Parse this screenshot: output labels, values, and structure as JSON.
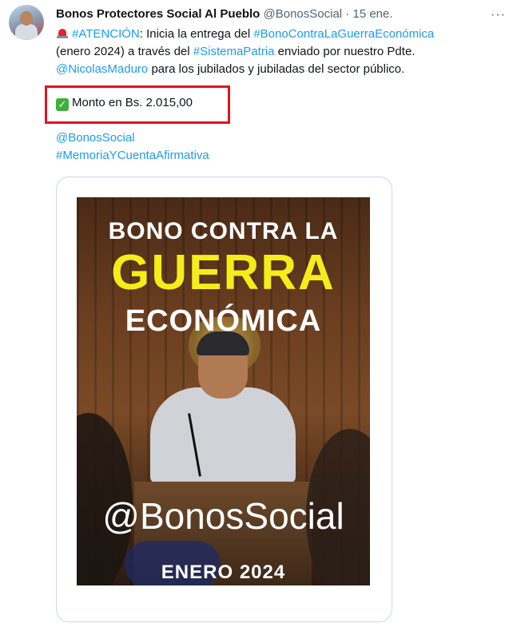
{
  "author": {
    "name": "Bonos Protectores Social Al Pueblo",
    "handle": "@BonosSocial",
    "separator": "·",
    "date": "15 ene."
  },
  "more_icon": "more-options-icon",
  "tweet": {
    "line1_hashtag_atencion": "#ATENCIÓN",
    "line1_text": ": Inicia la entrega del ",
    "line1_hashtag_bono": "#BonoContraLaGuerraEconómica",
    "line2_text_a": "(enero 2024) a través del ",
    "line2_hashtag_patria": "#SistemaPatria",
    "line2_text_b": " enviado por nuestro Pdte.",
    "line3_mention": "@NicolasMaduro",
    "line3_text": " para los jubilados y jubiladas del sector público.",
    "monto": "Monto en Bs. 2.015,00",
    "mention_bonos": "@BonosSocial",
    "hashtag_memoria": "#MemoriaYCuentaAfirmativa"
  },
  "image": {
    "line1": "BONO CONTRA LA",
    "line2": "GUERRA",
    "line3": "ECONÓMICA",
    "watermark": "@BonosSocial",
    "footer": "ENERO 2024"
  },
  "colors": {
    "link": "#1d9bf0",
    "highlight_border": "#e0141f",
    "title_yellow": "#f6ec1a"
  }
}
